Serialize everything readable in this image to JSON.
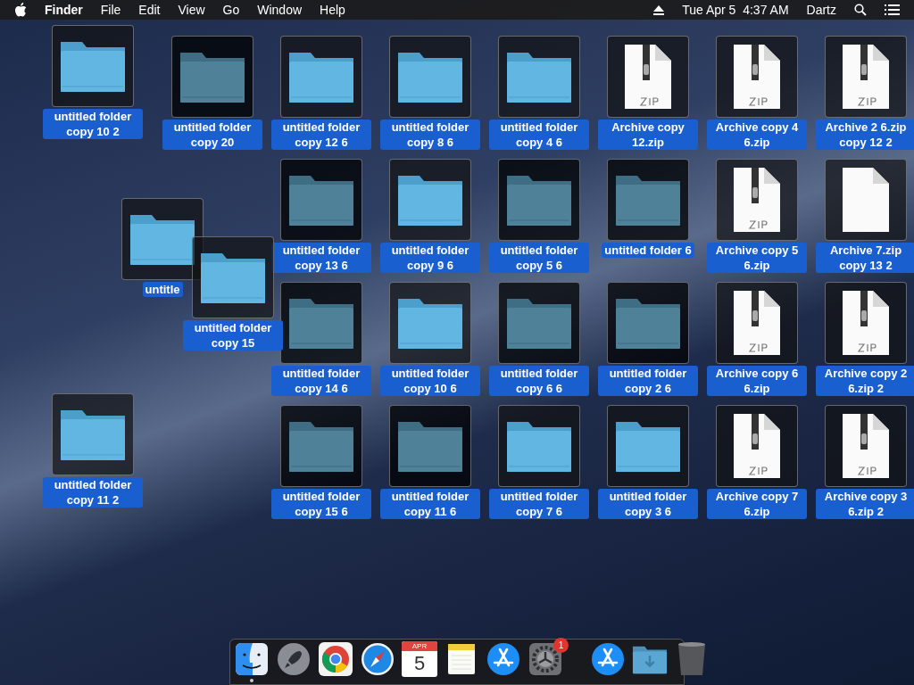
{
  "menu_bar": {
    "app_name": "Finder",
    "menus": [
      "File",
      "Edit",
      "View",
      "Go",
      "Window",
      "Help"
    ],
    "clock": "Tue Apr 5  4:37 AM",
    "user": "Dartz"
  },
  "desktop_icons": [
    {
      "kind": "folder",
      "label": "untitled folder copy 10 2",
      "dimmed": false
    },
    {
      "kind": "folder",
      "label": "untitled folder copy 20",
      "dimmed": true
    },
    {
      "kind": "folder",
      "label": "untitled folder copy 12 6",
      "dimmed": false
    },
    {
      "kind": "folder",
      "label": "untitled folder copy 8 6",
      "dimmed": false
    },
    {
      "kind": "folder",
      "label": "untitled folder copy 4 6",
      "dimmed": false
    },
    {
      "kind": "zip",
      "label": "Archive copy 12.zip",
      "dimmed": false
    },
    {
      "kind": "zip",
      "label": "Archive copy 4 6.zip",
      "dimmed": false
    },
    {
      "kind": "zip",
      "label": "Archive 2 6.zip copy 12 2",
      "dimmed": false
    },
    {
      "kind": "folder",
      "label": "untitled folder copy 13 6",
      "dimmed": true
    },
    {
      "kind": "folder",
      "label": "untitled folder copy 9 6",
      "dimmed": false
    },
    {
      "kind": "folder",
      "label": "untitled folder copy 5 6",
      "dimmed": true
    },
    {
      "kind": "folder",
      "label": "untitled folder 6",
      "dimmed": true
    },
    {
      "kind": "zip",
      "label": "Archive copy 5 6.zip",
      "dimmed": false
    },
    {
      "kind": "document",
      "label": "Archive 7.zip copy 13 2",
      "dimmed": false
    },
    {
      "kind": "folder",
      "label": "untitled folder copy 14 6",
      "dimmed": true
    },
    {
      "kind": "folder",
      "label": "untitled folder copy 10 6",
      "dimmed": false
    },
    {
      "kind": "folder",
      "label": "untitled folder copy 6 6",
      "dimmed": true
    },
    {
      "kind": "folder",
      "label": "untitled folder copy 2 6",
      "dimmed": true
    },
    {
      "kind": "zip",
      "label": "Archive copy 6 6.zip",
      "dimmed": false
    },
    {
      "kind": "zip",
      "label": "Archive copy 2 6.zip 2",
      "dimmed": false
    },
    {
      "kind": "folder",
      "label": "untitled folder copy 15 6",
      "dimmed": true
    },
    {
      "kind": "folder",
      "label": "untitled folder copy 11 6",
      "dimmed": true
    },
    {
      "kind": "folder",
      "label": "untitled folder copy 7 6",
      "dimmed": false
    },
    {
      "kind": "folder",
      "label": "untitled folder copy 3 6",
      "dimmed": false
    },
    {
      "kind": "zip",
      "label": "Archive copy 7 6.zip",
      "dimmed": false
    },
    {
      "kind": "zip",
      "label": "Archive copy 3 6.zip 2",
      "dimmed": false
    },
    {
      "kind": "folder",
      "label": "untitle",
      "dimmed": false
    },
    {
      "kind": "folder",
      "label": "untitled folder copy 15",
      "dimmed": false
    },
    {
      "kind": "folder",
      "label": "untitled folder copy 11 2",
      "dimmed": false
    }
  ],
  "dock": [
    {
      "kind": "finder",
      "running": true
    },
    {
      "kind": "launchpad",
      "running": false
    },
    {
      "kind": "chrome",
      "running": false
    },
    {
      "kind": "safari",
      "running": false
    },
    {
      "kind": "calendar",
      "running": false,
      "month": "APR",
      "day": "5"
    },
    {
      "kind": "notes",
      "running": false
    },
    {
      "kind": "appstore",
      "running": false
    },
    {
      "kind": "preferences",
      "running": false,
      "badge": "1"
    },
    {
      "kind": "separator"
    },
    {
      "kind": "appstore",
      "running": false
    },
    {
      "kind": "downloads",
      "running": false
    },
    {
      "kind": "trash",
      "running": false
    }
  ]
}
